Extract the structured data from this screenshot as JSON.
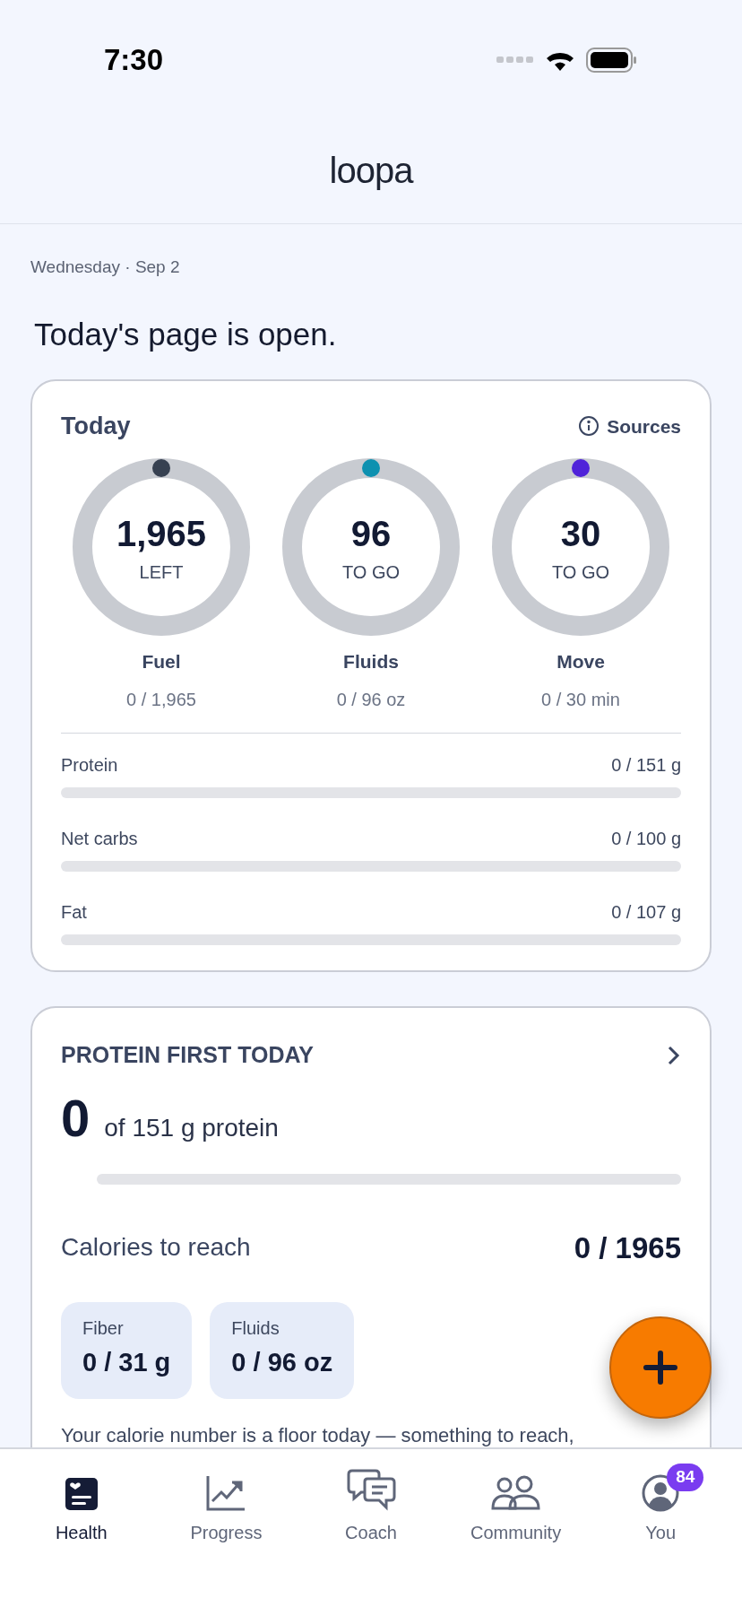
{
  "status_bar": {
    "time": "7:30"
  },
  "header": {
    "logo": "loopa"
  },
  "date": "Wednesday · Sep 2",
  "headline": "Today's page is open.",
  "today_card": {
    "title": "Today",
    "sources_link": "Sources",
    "rings": [
      {
        "value": "1,965",
        "caption": "LEFT",
        "label": "Fuel",
        "progress": "0 / 1,965",
        "color": "#374151"
      },
      {
        "value": "96",
        "caption": "TO GO",
        "label": "Fluids",
        "progress": "0 / 96 oz",
        "color": "#0e91b0"
      },
      {
        "value": "30",
        "caption": "TO GO",
        "label": "Move",
        "progress": "0 / 30 min",
        "color": "#4f23d9"
      }
    ],
    "macros": [
      {
        "label": "Protein",
        "amount": "0 / 151 g",
        "level": 0
      },
      {
        "label": "Net carbs",
        "amount": "0 / 100 g",
        "level": 0
      },
      {
        "label": "Fat",
        "amount": "0 / 107 g",
        "level": 0
      }
    ]
  },
  "protein_card": {
    "title": "PROTEIN FIRST TODAY",
    "amount": "0",
    "amount_label": "of 151 g protein",
    "level": 0,
    "calories_label": "Calories to reach",
    "calories_value": "0 / 1965",
    "chips": [
      {
        "label": "Fiber",
        "value": "0 / 31 g"
      },
      {
        "label": "Fluids",
        "value": "0 / 96 oz"
      }
    ],
    "note": "Your calorie number is a floor today — something to reach,"
  },
  "tab_bar": [
    {
      "label": "Health",
      "selected": true
    },
    {
      "label": "Progress",
      "selected": false
    },
    {
      "label": "Coach",
      "selected": false
    },
    {
      "label": "Community",
      "selected": false
    },
    {
      "label": "You",
      "selected": false,
      "badge": "84"
    }
  ]
}
